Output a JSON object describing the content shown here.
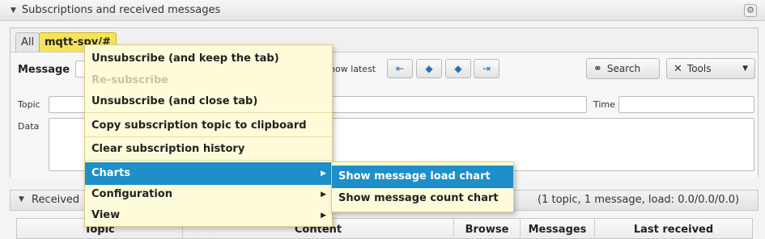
{
  "window": {
    "title": "Subscriptions and received messages"
  },
  "tabs": {
    "all": "All",
    "subscription": "mqtt-spy/#"
  },
  "message_panel": {
    "message_label": "Message",
    "show_latest_label": "how latest",
    "search_label": "Search",
    "tools_label": "Tools",
    "topic_label": "Topic",
    "time_label": "Time",
    "data_label": "Data"
  },
  "received_panel": {
    "title": "Received",
    "stats": "(1 topic, 1 message, load: 0.0/0.0/0.0)",
    "columns": [
      "Topic",
      "Content",
      "Browse",
      "Messages",
      "Last received"
    ]
  },
  "context_menu": {
    "items": [
      {
        "label": "Unsubscribe (and keep the tab)",
        "enabled": true
      },
      {
        "label": "Re-subscribe",
        "enabled": false
      },
      {
        "label": "Unsubscribe (and close tab)",
        "enabled": true
      },
      {
        "label": "Copy subscription topic to clipboard",
        "enabled": true
      },
      {
        "label": "Clear subscription history",
        "enabled": true
      },
      {
        "label": "Charts",
        "enabled": true,
        "submenu": true,
        "highlighted": true
      },
      {
        "label": "Configuration",
        "enabled": true,
        "submenu": true
      },
      {
        "label": "View",
        "enabled": true,
        "submenu": true
      }
    ]
  },
  "charts_submenu": {
    "items": [
      {
        "label": "Show message load chart",
        "highlighted": true
      },
      {
        "label": "Show message count chart"
      }
    ]
  },
  "colors": {
    "menu_background": "#fdfbd9",
    "highlight": "#1e8fc8",
    "tab_active": "#f5e45a"
  },
  "icons": [
    "collapse-triangle-icon",
    "gear-icon",
    "first-icon",
    "previous-icon",
    "next-icon",
    "last-icon",
    "binoculars-icon",
    "tools-icon",
    "dropdown-arrow-icon",
    "submenu-arrow-icon"
  ]
}
